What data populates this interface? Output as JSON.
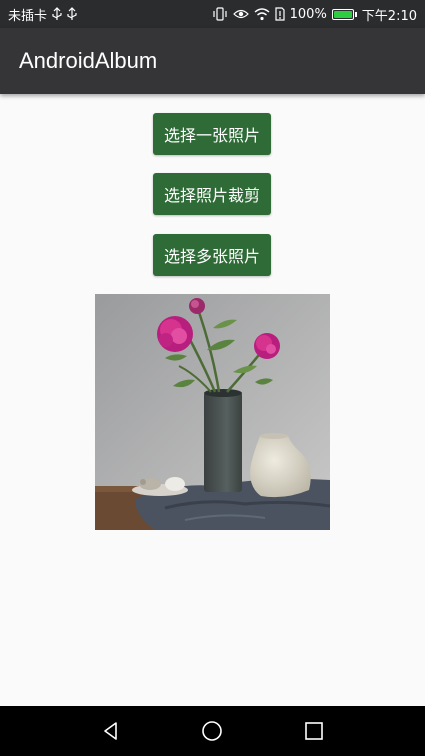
{
  "status_bar": {
    "carrier": "未插卡",
    "battery_percent": "100%",
    "time": "下午2:10",
    "battery_level": 1.0,
    "icons": [
      "usb-icon",
      "usb-icon",
      "vibrate-icon",
      "eye-icon",
      "wifi-icon",
      "sim-icon",
      "battery-icon"
    ]
  },
  "toolbar": {
    "title": "AndroidAlbum"
  },
  "buttons": {
    "select_one": "选择一张照片",
    "select_crop": "选择照片裁剪",
    "select_multiple": "选择多张照片"
  },
  "colors": {
    "toolbar": "#353538",
    "status_bar": "#2b2c2e",
    "button": "#2e6b36",
    "background": "#fafafa"
  },
  "nav_bar": {
    "icons": [
      "back-icon",
      "home-icon",
      "recents-icon"
    ]
  }
}
